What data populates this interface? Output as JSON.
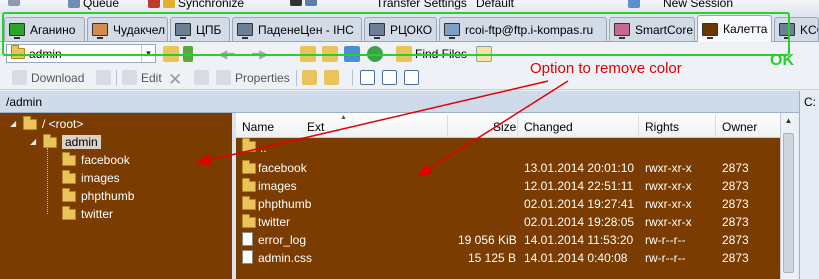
{
  "topbar": {
    "queue_label": "Queue",
    "synchronize_label": "Synchronize",
    "transfer_settings_label": "Transfer Settings",
    "transfer_settings_value": "Default",
    "new_session_label": "New Session"
  },
  "tabs": [
    {
      "label": "Аганино",
      "color": "#2aa52a"
    },
    {
      "label": "Чудакчел",
      "color": "#d58a4e"
    },
    {
      "label": "ЦПБ",
      "color": "#6b7f96"
    },
    {
      "label": "ПаденеЦен - IHC",
      "color": "#6b7f96"
    },
    {
      "label": "РЦОКО",
      "color": "#6b7f96"
    },
    {
      "label": "rcoi-ftp@ftp.i-kompas.ru",
      "color": "#7da0c8"
    },
    {
      "label": "SmartCore",
      "color": "#c46a8c"
    },
    {
      "label": "Калетта",
      "color": "#6b3900"
    },
    {
      "label": "KCC",
      "color": "#6b7f96"
    }
  ],
  "path_combo": {
    "value": "admin"
  },
  "toolbar": {
    "find_files_label": "Find Files"
  },
  "actions": {
    "download_label": "Download",
    "edit_label": "Edit",
    "properties_label": "Properties"
  },
  "annotations": {
    "option_text": "Option to remove color",
    "ok_text": "OK"
  },
  "current_path": "/admin",
  "right_strip_label": "C:",
  "tree": {
    "root_label": "/ <root>",
    "admin_label": "admin",
    "children": [
      "facebook",
      "images",
      "phpthumb",
      "twitter"
    ]
  },
  "file_columns": {
    "name": "Name",
    "ext": "Ext",
    "size": "Size",
    "changed": "Changed",
    "rights": "Rights",
    "owner": "Owner"
  },
  "files": [
    {
      "name": "..",
      "size": "",
      "changed": "",
      "rights": "",
      "owner": "",
      "type": "up"
    },
    {
      "name": "facebook",
      "size": "",
      "changed": "13.01.2014 20:01:10",
      "rights": "rwxr-xr-x",
      "owner": "2873",
      "type": "folder"
    },
    {
      "name": "images",
      "size": "",
      "changed": "12.01.2014 22:51:11",
      "rights": "rwxr-xr-x",
      "owner": "2873",
      "type": "folder"
    },
    {
      "name": "phpthumb",
      "size": "",
      "changed": "02.01.2014 19:27:41",
      "rights": "rwxr-xr-x",
      "owner": "2873",
      "type": "folder"
    },
    {
      "name": "twitter",
      "size": "",
      "changed": "02.01.2014 19:28:05",
      "rights": "rwxr-xr-x",
      "owner": "2873",
      "type": "folder"
    },
    {
      "name": "error_log",
      "size": "19 056 KiB",
      "changed": "14.01.2014 11:53:20",
      "rights": "rw-r--r--",
      "owner": "2873",
      "type": "file"
    },
    {
      "name": "admin.css",
      "size": "15 125 B",
      "changed": "14.01.2014 0:40:08",
      "rights": "rw-r--r--",
      "owner": "2873",
      "type": "file"
    }
  ],
  "colors": {
    "panel_background": "#7a3c00",
    "annotation_red": "#e10000",
    "highlight_green": "#2bcf2b"
  }
}
